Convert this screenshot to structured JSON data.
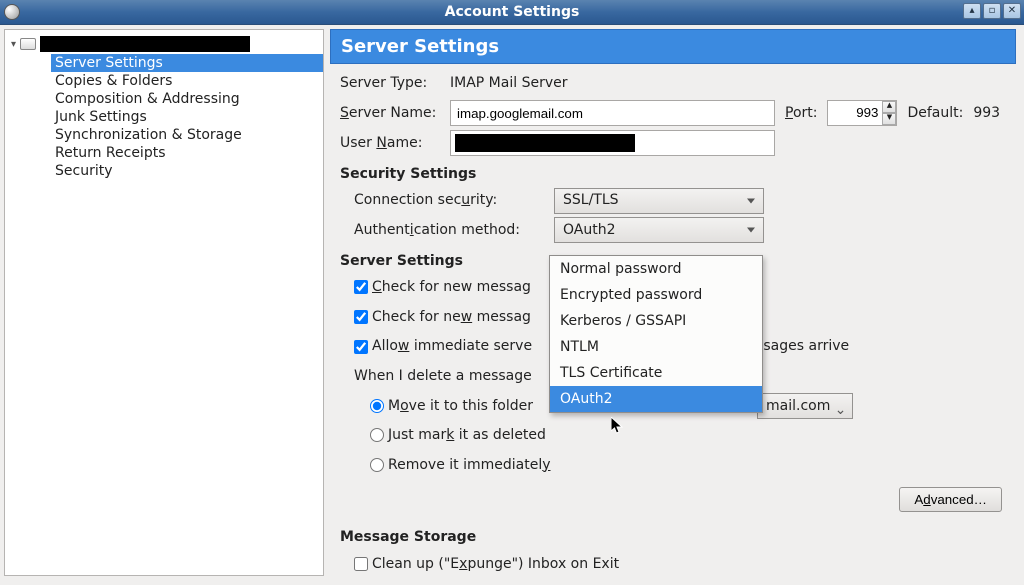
{
  "window": {
    "title": "Account Settings"
  },
  "sidebar": {
    "root_label": "",
    "items": [
      "Server Settings",
      "Copies & Folders",
      "Composition & Addressing",
      "Junk Settings",
      "Synchronization & Storage",
      "Return Receipts",
      "Security"
    ],
    "selected_index": 0
  },
  "main": {
    "header": "Server Settings",
    "server_type_label": "Server Type:",
    "server_type_value": "IMAP Mail Server",
    "server_name_label": "Server Name:",
    "server_name_value": "imap.googlemail.com",
    "port_label": "Port:",
    "port_value": "993",
    "default_label": "Default:",
    "default_value": "993",
    "user_name_label": "User Name:",
    "user_name_value": "",
    "security_settings_title": "Security Settings",
    "connection_security_label": "Connection security:",
    "connection_security_value": "SSL/TLS",
    "auth_method_label": "Authentication method:",
    "auth_method_value": "OAuth2",
    "auth_method_options": [
      "Normal password",
      "Encrypted password",
      "Kerberos / GSSAPI",
      "NTLM",
      "TLS Certificate",
      "OAuth2"
    ],
    "auth_method_selected_index": 5,
    "server_settings_title": "Server Settings",
    "check_startup": {
      "label_pre": "Check for new messag",
      "checked": true
    },
    "check_interval": {
      "label_pre": "Check for new messag",
      "checked": true
    },
    "allow_immediate": {
      "label_pre": "Allow immediate serve",
      "label_post": "ssages arrive",
      "checked": true
    },
    "delete_label": "When I delete a message",
    "radio_move_label": "Move it to this folder",
    "trash_folder_tail": "mail.com",
    "radio_mark_label": "Just mark it as deleted",
    "radio_remove_label": "Remove it immediately",
    "advanced_label": "Advanced…",
    "message_storage_title": "Message Storage",
    "expunge_label": "Clean up (\"Expunge\") Inbox on Exit",
    "expunge_checked": false
  }
}
